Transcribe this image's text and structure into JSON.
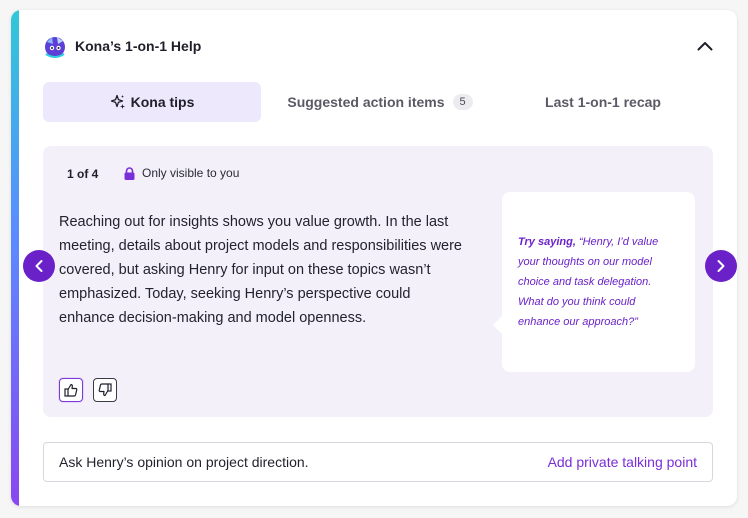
{
  "header": {
    "title": "Kona’s 1-on-1 Help",
    "logo_icon": "kona-logo-icon",
    "collapse_icon": "chevron-up-icon"
  },
  "tabs": [
    {
      "label": "Kona tips",
      "icon": "sparkle-icon",
      "active": true
    },
    {
      "label": "Suggested action items",
      "badge": "5",
      "active": false
    },
    {
      "label": "Last 1-on-1 recap",
      "active": false
    }
  ],
  "tip": {
    "counter": "1 of 4",
    "visibility": "Only visible to you",
    "body": "Reaching out for insights shows you value growth. In the last meeting, details about project models and responsibilities were covered, but asking Henry for input on these topics wasn’t emphasized. Today, seeking Henry’s perspective could enhance decision-making and model openness.",
    "suggestion_lead": "Try saying,",
    "suggestion_quote": "“Henry, I’d value your thoughts on our model choice and task delegation. What do you think could enhance our approach?”"
  },
  "talking_point": {
    "text": "Ask Henry’s opinion on project direction.",
    "action": "Add private talking point"
  },
  "colors": {
    "brand_purple": "#6a22c8",
    "active_tab_bg": "#ede8fb",
    "panel_bg": "#f3f0fa",
    "link_purple": "#7a2ed8"
  }
}
